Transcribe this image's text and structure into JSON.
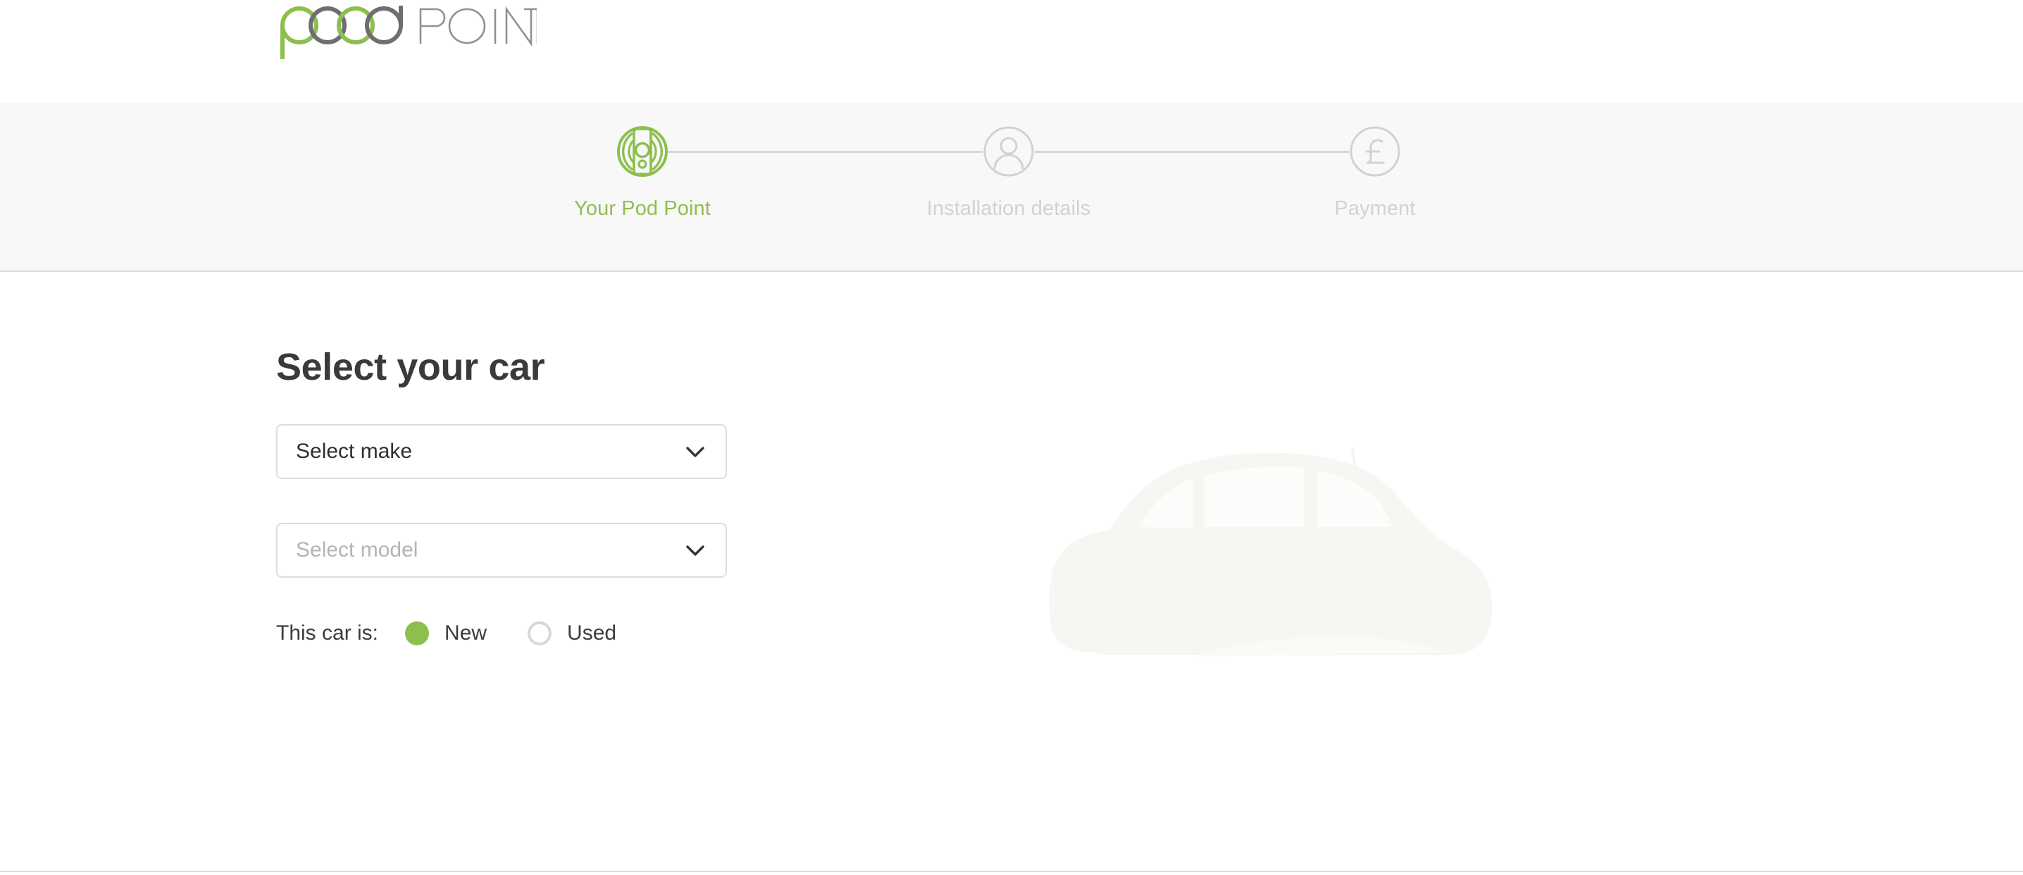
{
  "brand": {
    "logo_text_primary": "pod",
    "logo_text_secondary": "POINT",
    "green": "#8dbf4f",
    "grey": "#6d6e71"
  },
  "stepper": {
    "steps": [
      {
        "label": "Your Pod Point",
        "icon": "pod-charger-icon",
        "state": "active"
      },
      {
        "label": "Installation details",
        "icon": "person-icon",
        "state": "inactive"
      },
      {
        "label": "Payment",
        "icon": "pound-sterling-icon",
        "state": "inactive"
      }
    ]
  },
  "main": {
    "title": "Select your car",
    "make_select": {
      "value": "Select make",
      "icon": "chevron-down-icon",
      "state": "enabled"
    },
    "model_select": {
      "value": "Select model",
      "icon": "chevron-down-icon",
      "state": "disabled"
    },
    "condition": {
      "label": "This car is:",
      "options": [
        {
          "label": "New",
          "selected": true
        },
        {
          "label": "Used",
          "selected": false
        }
      ]
    },
    "illustration": "ghost-car-silhouette"
  }
}
